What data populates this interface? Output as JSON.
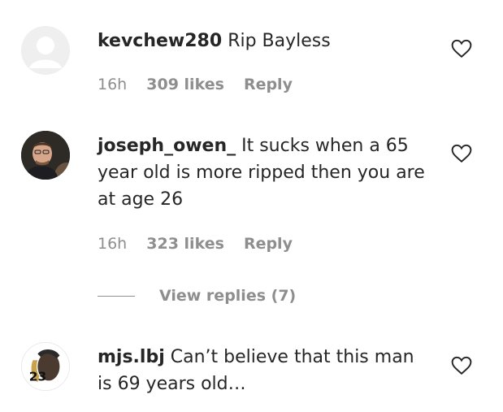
{
  "comments": [
    {
      "username": "kevchew280",
      "text": "Rip Bayless",
      "time": "16h",
      "likes": "309 likes",
      "reply": "Reply",
      "avatar": "default-avatar-icon"
    },
    {
      "username": "joseph_owen_",
      "text": "It sucks when a 65 year old is more ripped then you are at age 26",
      "time": "16h",
      "likes": "323 likes",
      "reply": "Reply",
      "avatar": "user-photo"
    },
    {
      "username": "mjs.lbj",
      "text": "Can’t believe that this man is 69 years old…",
      "avatar": "user-photo"
    }
  ],
  "view_replies": {
    "label": "View replies (7)"
  },
  "colors": {
    "text": "#262626",
    "muted": "#8e8e8e",
    "avatar_placeholder": "#dbdbdb"
  }
}
